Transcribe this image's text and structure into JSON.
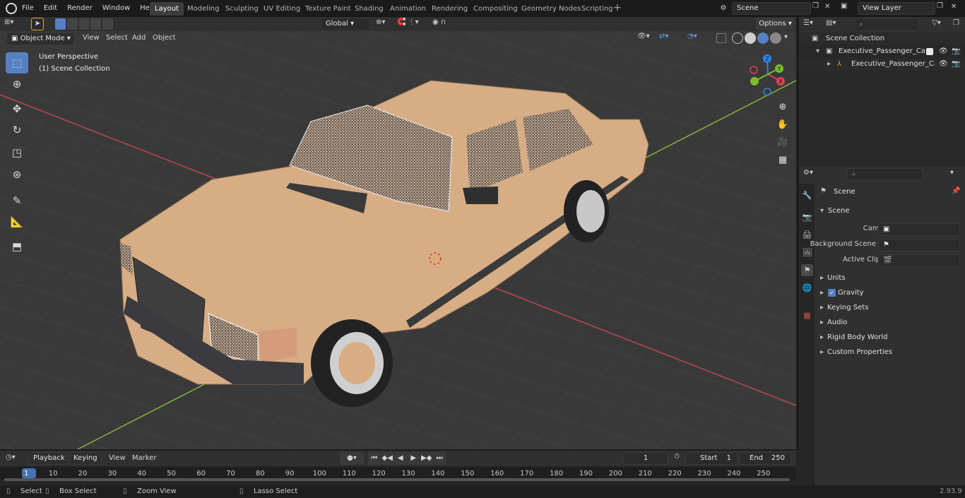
{
  "menubar": {
    "items": [
      "File",
      "Edit",
      "Render",
      "Window",
      "Help"
    ]
  },
  "workspaces": [
    "Layout",
    "Modeling",
    "Sculpting",
    "UV Editing",
    "Texture Paint",
    "Shading",
    "Animation",
    "Rendering",
    "Compositing",
    "Geometry Nodes",
    "Scripting"
  ],
  "active_workspace": "Layout",
  "scene_field": "Scene",
  "viewlayer_field": "View Layer",
  "toolbar": {
    "transform_orientation": "Global",
    "options": "Options"
  },
  "viewport_header": {
    "mode": "Object Mode",
    "menus": [
      "View",
      "Select",
      "Add",
      "Object"
    ]
  },
  "viewport": {
    "line1": "User Perspective",
    "line2": "(1) Scene Collection",
    "gizmo": {
      "x": "X",
      "y": "Y",
      "z": "Z"
    }
  },
  "tools": [
    "select-box",
    "cursor",
    "move",
    "rotate",
    "scale",
    "transform",
    "annotate",
    "measure",
    "add-cube"
  ],
  "outliner": {
    "root": "Scene Collection",
    "items": [
      {
        "label": "Executive_Passenger_Car_SE"
      },
      {
        "label": "Executive_Passenger_Ca"
      }
    ]
  },
  "properties": {
    "title": "Scene",
    "section": "Scene",
    "camera_label": "Camera",
    "bg_label": "Background Scene",
    "clip_label": "Active Clip",
    "panels": [
      "Units",
      "Gravity",
      "Keying Sets",
      "Audio",
      "Rigid Body World",
      "Custom Properties"
    ]
  },
  "timeline": {
    "menus": [
      "Playback",
      "Keying",
      "View",
      "Marker"
    ],
    "current_frame": "1",
    "start_label": "Start",
    "start": "1",
    "end_label": "End",
    "end": "250",
    "ticks": [
      "1",
      "10",
      "20",
      "30",
      "40",
      "50",
      "60",
      "70",
      "80",
      "90",
      "100",
      "110",
      "120",
      "130",
      "140",
      "150",
      "160",
      "170",
      "180",
      "190",
      "200",
      "210",
      "220",
      "230",
      "240",
      "250"
    ]
  },
  "statusbar": {
    "select": "Select",
    "box_select": "Box Select",
    "zoom_view": "Zoom View",
    "lasso_select": "Lasso Select",
    "version": "2.93.9"
  },
  "colors": {
    "accent": "#5680c2",
    "car_body": "#d7ad85",
    "grid_bg": "#393939",
    "x_axis": "#b84552",
    "y_axis": "#7fae3e"
  }
}
